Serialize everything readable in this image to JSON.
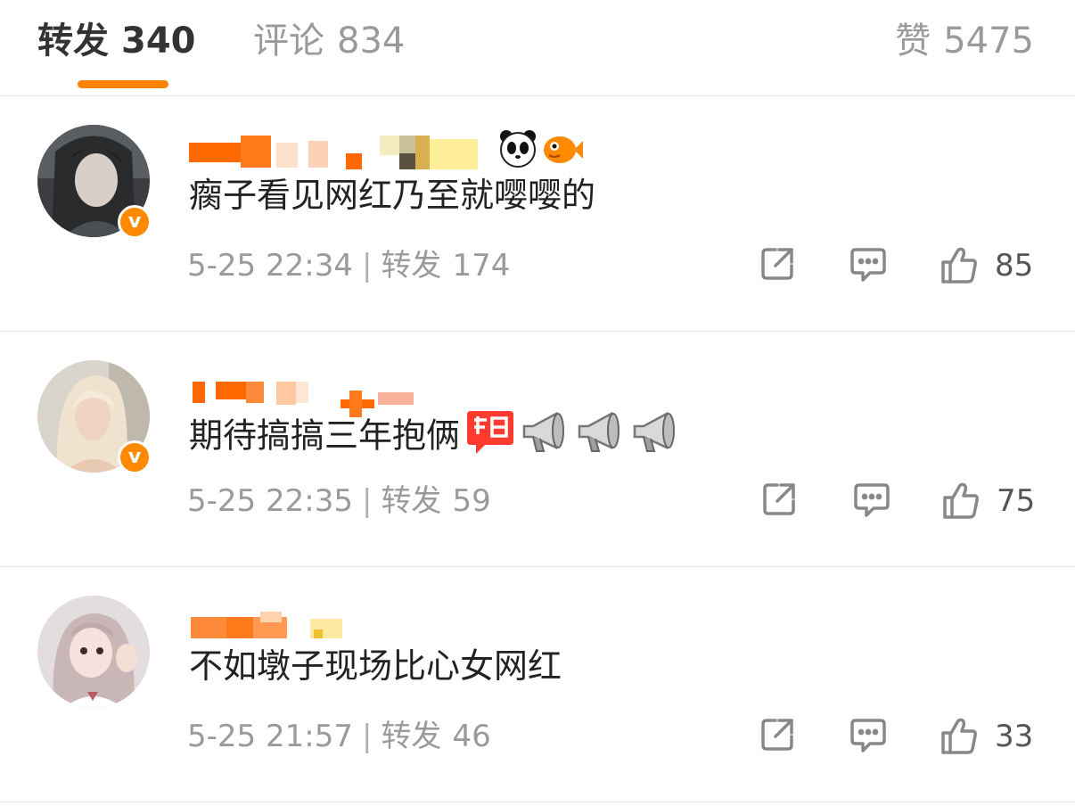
{
  "tabs": {
    "repost": {
      "label": "转发",
      "count": "340"
    },
    "comment": {
      "label": "评论",
      "count": "834"
    },
    "like": {
      "label": "赞",
      "count": "5475"
    }
  },
  "accent_color": "#ff8200",
  "comments": [
    {
      "text": "瘸子看见网红乃至就嘤嘤的",
      "verified": true,
      "time": "5-25 22:34",
      "repost_label": "转发",
      "repost_count": "174",
      "like_count": "85",
      "name_emojis": [
        "panda-emoji",
        "fish-emoji"
      ]
    },
    {
      "text": "期待搞搞三年抱俩",
      "verified": true,
      "time": "5-25 22:35",
      "repost_label": "转发",
      "repost_count": "59",
      "like_count": "75",
      "text_emojis": [
        "给力-emoji",
        "megaphone-emoji",
        "megaphone-emoji",
        "megaphone-emoji"
      ]
    },
    {
      "text": "不如墩子现场比心女网红",
      "verified": false,
      "time": "5-25 21:57",
      "repost_label": "转发",
      "repost_count": "46",
      "like_count": "33"
    }
  ]
}
